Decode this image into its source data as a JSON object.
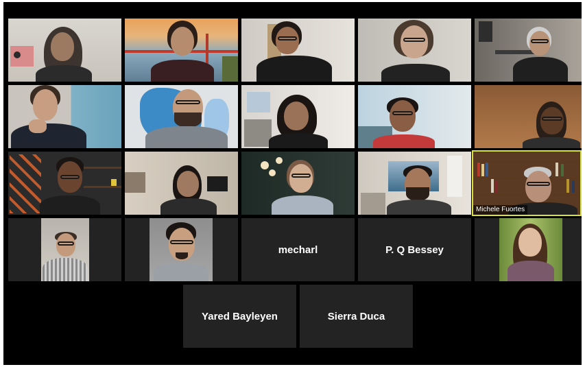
{
  "meeting": {
    "participants": [
      {
        "id": "p1"
      },
      {
        "id": "p2"
      },
      {
        "id": "p3"
      },
      {
        "id": "p4"
      },
      {
        "id": "p5"
      },
      {
        "id": "p6"
      },
      {
        "id": "p7"
      },
      {
        "id": "p8"
      },
      {
        "id": "p9"
      },
      {
        "id": "p10"
      },
      {
        "id": "p11"
      },
      {
        "id": "p12"
      },
      {
        "id": "p13"
      },
      {
        "id": "p14"
      },
      {
        "id": "p15",
        "name": "Michele Fuortes",
        "active_speaker": true
      },
      {
        "id": "p16"
      },
      {
        "id": "p17"
      },
      {
        "id": "p18",
        "name": "mecharl",
        "video": false
      },
      {
        "id": "p19",
        "name": "P. Q Bessey",
        "video": false
      },
      {
        "id": "p20"
      },
      {
        "id": "p21",
        "name": "Yared Bayleyen",
        "video": false
      },
      {
        "id": "p22",
        "name": "Sierra Duca",
        "video": false
      }
    ],
    "colors": {
      "background": "#000000",
      "tile_empty": "#232323",
      "active_speaker_border": "#d8e13f",
      "name_text": "#ffffff"
    }
  }
}
